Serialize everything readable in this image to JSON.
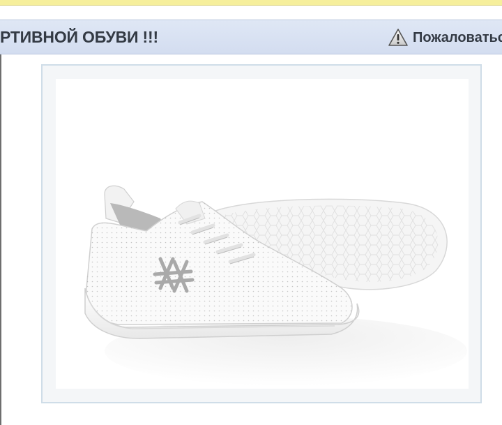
{
  "header": {
    "title": "РТИВНОЙ ОБУВИ !!!",
    "report_label": "Пожаловаться",
    "report_icon": "warning-icon"
  },
  "product_image": {
    "icon": "sneaker-photo",
    "alt": "White perforated sneakers"
  },
  "colors": {
    "header_bg": "#d3ddf0",
    "top_strip": "#f6ef9c",
    "frame_border": "#cfdde8"
  }
}
